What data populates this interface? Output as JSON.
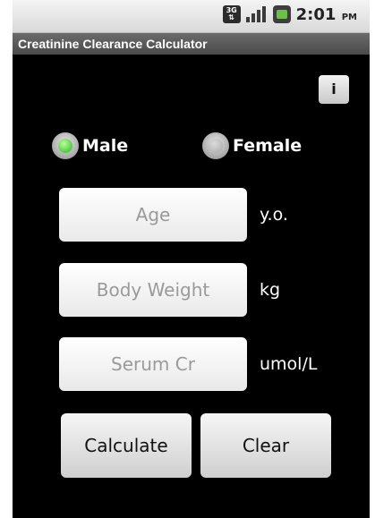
{
  "status_bar": {
    "network_label": "3G",
    "time": "2:01",
    "ampm": "PM",
    "icons": [
      "3g-icon",
      "signal-icon",
      "battery-icon"
    ]
  },
  "app": {
    "title": "Creatinine Clearance Calculator"
  },
  "info_button": {
    "label": "i"
  },
  "sex": {
    "options": [
      {
        "label": "Male",
        "selected": true
      },
      {
        "label": "Female",
        "selected": false
      }
    ]
  },
  "fields": {
    "age": {
      "placeholder": "Age",
      "unit": "y.o."
    },
    "weight": {
      "placeholder": "Body Weight",
      "unit": "kg"
    },
    "serum_cr": {
      "placeholder": "Serum Cr",
      "unit": "umol/L"
    }
  },
  "buttons": {
    "calculate": "Calculate",
    "clear": "Clear"
  },
  "colors": {
    "selected_radio": "#28b21f",
    "background": "#000000",
    "title_bar": "#555555"
  }
}
